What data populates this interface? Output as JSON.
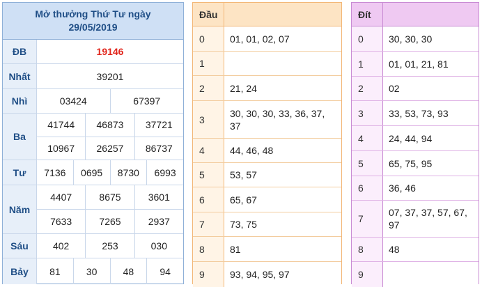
{
  "results": {
    "title_line1": "Mở thưởng Thứ Tư ngày",
    "title_line2": "29/05/2019",
    "prizes": {
      "db": {
        "label": "ĐB",
        "numbers": [
          "19146"
        ]
      },
      "nhat": {
        "label": "Nhất",
        "numbers": [
          "39201"
        ]
      },
      "nhi": {
        "label": "Nhì",
        "numbers": [
          "03424",
          "67397"
        ]
      },
      "ba": {
        "label": "Ba",
        "numbers": [
          "41744",
          "46873",
          "37721",
          "10967",
          "26257",
          "86737"
        ]
      },
      "tu": {
        "label": "Tư",
        "numbers": [
          "7136",
          "0695",
          "8730",
          "6993"
        ]
      },
      "nam": {
        "label": "Năm",
        "numbers": [
          "4407",
          "8675",
          "3601",
          "7633",
          "7265",
          "2937"
        ]
      },
      "sau": {
        "label": "Sáu",
        "numbers": [
          "402",
          "253",
          "030"
        ]
      },
      "bay": {
        "label": "Bảy",
        "numbers": [
          "81",
          "30",
          "48",
          "94"
        ]
      }
    }
  },
  "dau": {
    "header": "Đầu",
    "rows": [
      {
        "key": "0",
        "value": "01, 01, 02, 07"
      },
      {
        "key": "1",
        "value": ""
      },
      {
        "key": "2",
        "value": "21, 24"
      },
      {
        "key": "3",
        "value": "30, 30, 30, 33, 36, 37, 37"
      },
      {
        "key": "4",
        "value": "44, 46, 48"
      },
      {
        "key": "5",
        "value": "53, 57"
      },
      {
        "key": "6",
        "value": "65, 67"
      },
      {
        "key": "7",
        "value": "73, 75"
      },
      {
        "key": "8",
        "value": "81"
      },
      {
        "key": "9",
        "value": "93, 94, 95, 97"
      }
    ]
  },
  "dit": {
    "header": "Đít",
    "rows": [
      {
        "key": "0",
        "value": "30, 30, 30"
      },
      {
        "key": "1",
        "value": "01, 01, 21, 81"
      },
      {
        "key": "2",
        "value": "02"
      },
      {
        "key": "3",
        "value": "33, 53, 73, 93"
      },
      {
        "key": "4",
        "value": "24, 44, 94"
      },
      {
        "key": "5",
        "value": "65, 75, 95"
      },
      {
        "key": "6",
        "value": "36, 46"
      },
      {
        "key": "7",
        "value": "07, 37, 37, 57, 67, 97"
      },
      {
        "key": "8",
        "value": "48"
      },
      {
        "key": "9",
        "value": ""
      }
    ]
  },
  "colors": {
    "special_number": "#e1261c",
    "results_header": "#cfe0f5",
    "dau_header": "#fde4c4",
    "dit_header": "#efc9f2"
  }
}
